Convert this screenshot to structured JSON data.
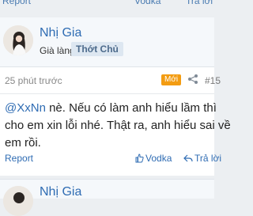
{
  "topbar": {
    "report": "Report",
    "vodka": "Vodka",
    "reply": "Trả lời"
  },
  "post": {
    "username": "Nhị Gia",
    "rank": "Già làng",
    "owner_badge": "Thớt Chủ",
    "time": "25 phút trước",
    "new_badge": "Mới",
    "post_number": "#15",
    "mention": "@XxNn",
    "content_line1": " nè. Nếu có làm anh hiểu lầm thì",
    "content_line2": "cho em xin lỗi nhé. Thật ra, anh hiểu sai về",
    "content_line3": "em rồi.",
    "report": "Report",
    "vodka": "Vodka",
    "reply": "Trả lời"
  },
  "next_post": {
    "username": "Nhị Gia"
  },
  "icons": {
    "share": "share-icon",
    "vodka": "thumbs-up-icon",
    "reply": "reply-icon"
  },
  "colors": {
    "link": "#2f6cb3",
    "new_badge": "#f39c12",
    "header_bg": "#f5f8fb"
  }
}
